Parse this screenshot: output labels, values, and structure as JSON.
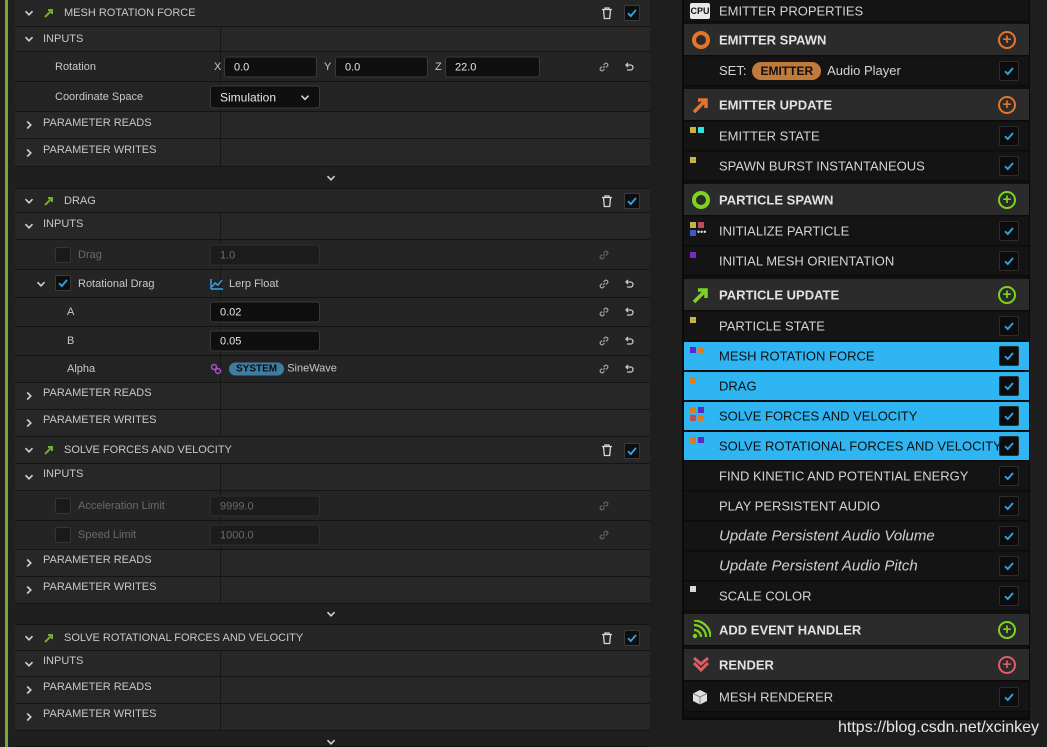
{
  "left_panel": {
    "modules": [
      {
        "title": "MESH ROTATION FORCE",
        "inputs_label": "INPUTS",
        "rotation": {
          "label": "Rotation",
          "x_label": "X",
          "x": "0.0",
          "y_label": "Y",
          "y": "0.0",
          "z_label": "Z",
          "z": "22.0"
        },
        "coordinate_space": {
          "label": "Coordinate Space",
          "value": "Simulation"
        },
        "param_reads": "PARAMETER READS",
        "param_writes": "PARAMETER WRITES"
      },
      {
        "title": "DRAG",
        "inputs_label": "INPUTS",
        "drag": {
          "label": "Drag",
          "value": "1.0"
        },
        "rotational_drag": {
          "label": "Rotational Drag",
          "value": "Lerp Float"
        },
        "a": {
          "label": "A",
          "value": "0.02"
        },
        "b": {
          "label": "B",
          "value": "0.05"
        },
        "alpha": {
          "label": "Alpha",
          "badge": "SYSTEM",
          "value": "SineWave"
        },
        "param_reads": "PARAMETER READS",
        "param_writes": "PARAMETER WRITES"
      },
      {
        "title": "SOLVE FORCES AND VELOCITY",
        "inputs_label": "INPUTS",
        "accel": {
          "label": "Acceleration Limit",
          "value": "9999.0"
        },
        "speed": {
          "label": "Speed Limit",
          "value": "1000.0"
        },
        "param_reads": "PARAMETER READS",
        "param_writes": "PARAMETER WRITES"
      },
      {
        "title": "SOLVE ROTATIONAL FORCES AND VELOCITY",
        "inputs_label": "INPUTS",
        "param_reads": "PARAMETER READS",
        "param_writes": "PARAMETER WRITES"
      }
    ]
  },
  "right_panel": {
    "cpu_label": "CPU",
    "emitter_properties": "EMITTER PROPERTIES",
    "emitter_spawn": "EMITTER SPAWN",
    "set_label": "SET:",
    "set_badge": "EMITTER",
    "set_value": "Audio Player",
    "emitter_update": "EMITTER UPDATE",
    "emitter_state": "EMITTER STATE",
    "spawn_burst": "SPAWN BURST INSTANTANEOUS",
    "particle_spawn": "PARTICLE SPAWN",
    "initialize_particle": "INITIALIZE PARTICLE",
    "initial_mesh_orientation": "INITIAL MESH ORIENTATION",
    "particle_update": "PARTICLE UPDATE",
    "particle_state": "PARTICLE STATE",
    "mesh_rotation_force": "MESH ROTATION FORCE",
    "drag": "DRAG",
    "solve_forces": "SOLVE FORCES AND VELOCITY",
    "solve_rot_forces": "SOLVE ROTATIONAL FORCES AND VELOCITY",
    "find_kinetic": "FIND KINETIC AND POTENTIAL ENERGY",
    "play_audio": "PLAY PERSISTENT AUDIO",
    "update_volume": "Update Persistent Audio Volume",
    "update_pitch": "Update Persistent Audio Pitch",
    "scale_color": "SCALE COLOR",
    "add_event_handler": "ADD EVENT HANDLER",
    "render": "RENDER",
    "mesh_renderer": "MESH RENDERER"
  },
  "watermark": "https://blog.csdn.net/xcinkey",
  "colors": {
    "accent_blue": "#2fb6f2",
    "rail_green": "#6fae2e",
    "spawn_orange": "#e3742b",
    "particle_green": "#7ed321",
    "render_red": "#e05d66"
  }
}
